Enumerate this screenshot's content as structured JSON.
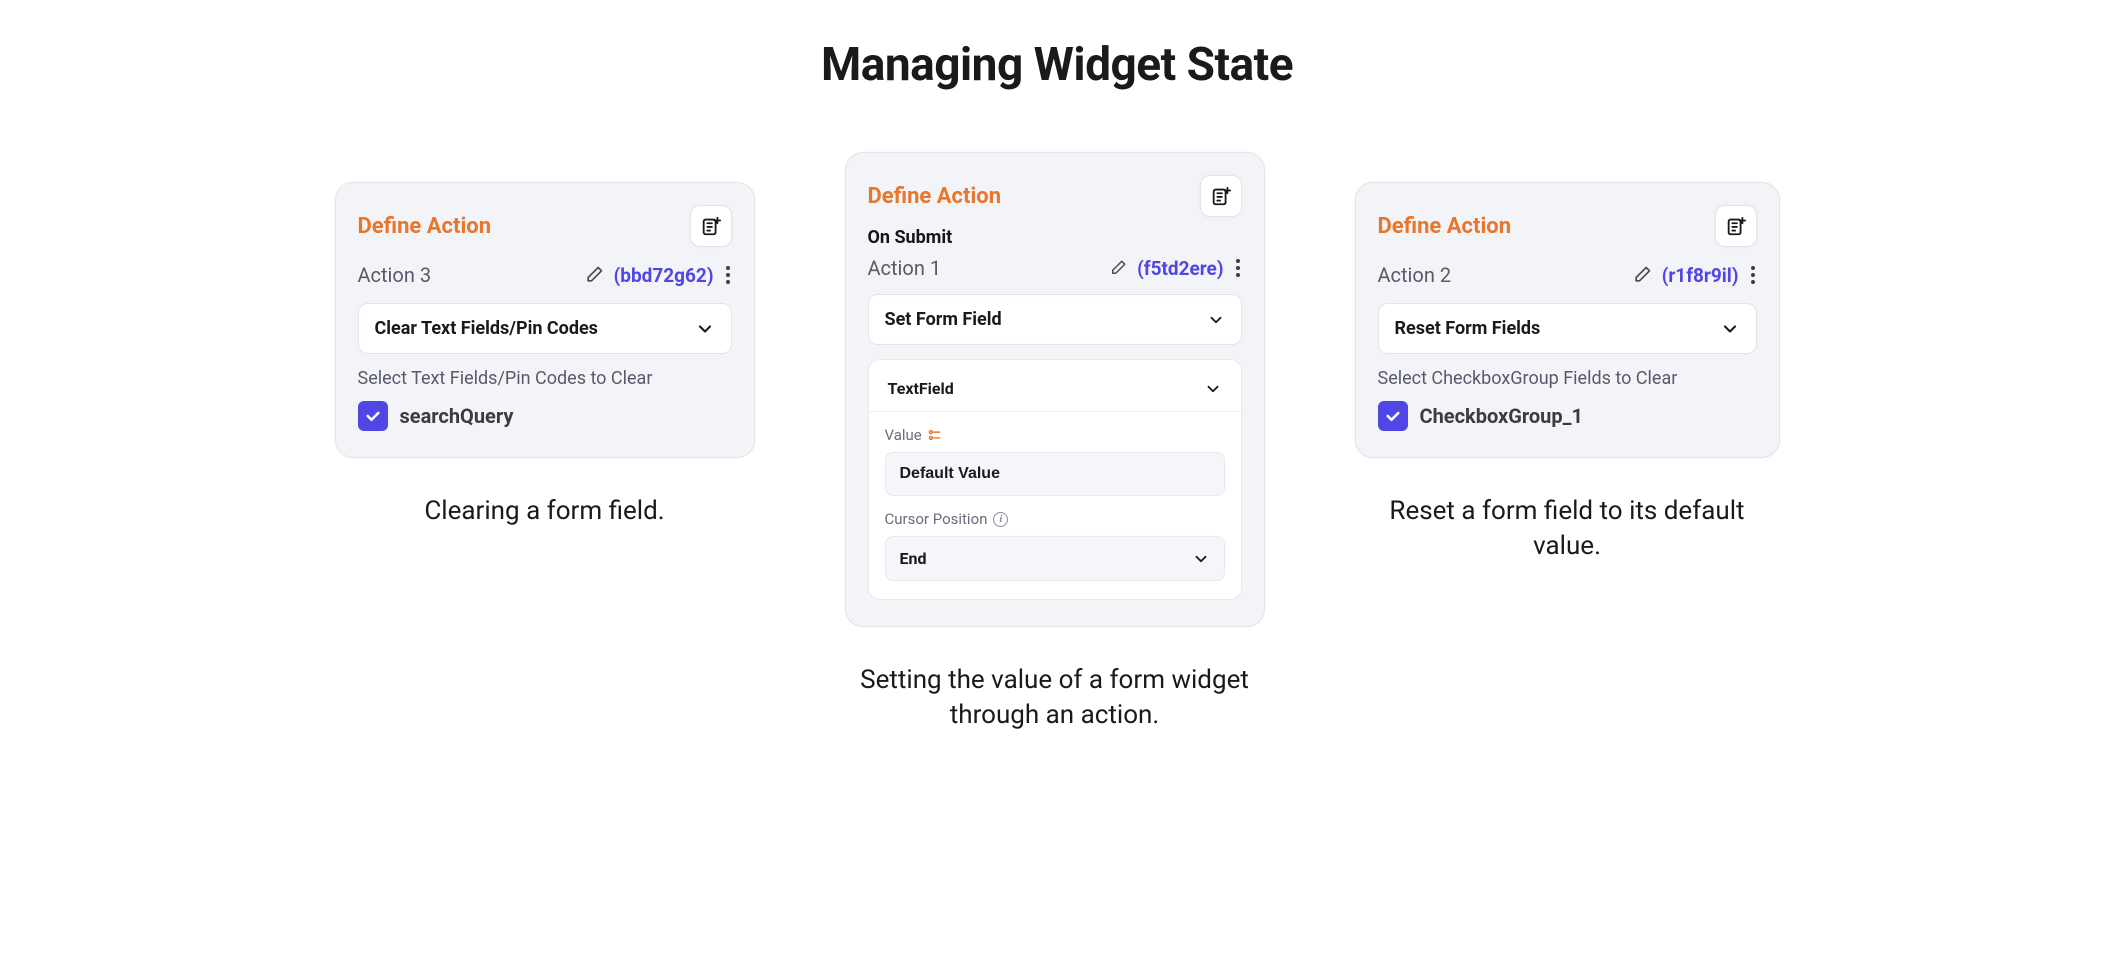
{
  "title": "Managing Widget State",
  "panels": {
    "left": {
      "header": "Define Action",
      "action_label": "Action 3",
      "action_id": "(bbd72g62)",
      "dropdown": "Clear Text Fields/Pin Codes",
      "helper": "Select Text Fields/Pin Codes to Clear",
      "checkbox_label": "searchQuery",
      "caption": "Clearing a form field."
    },
    "middle": {
      "header": "Define Action",
      "trigger": "On Submit",
      "action_label": "Action 1",
      "action_id": "(f5td2ere)",
      "dropdown": "Set Form Field",
      "target_dropdown": "TextField",
      "value_label": "Value",
      "value_input": "Default Value",
      "cursor_label": "Cursor Position",
      "cursor_dropdown": "End",
      "caption": "Setting the value of a form widget through an action."
    },
    "right": {
      "header": "Define Action",
      "action_label": "Action 2",
      "action_id": "(r1f8r9il)",
      "dropdown": "Reset Form Fields",
      "helper": "Select CheckboxGroup Fields to Clear",
      "checkbox_label": "CheckboxGroup_1",
      "caption": "Reset a form field to its default value."
    }
  }
}
